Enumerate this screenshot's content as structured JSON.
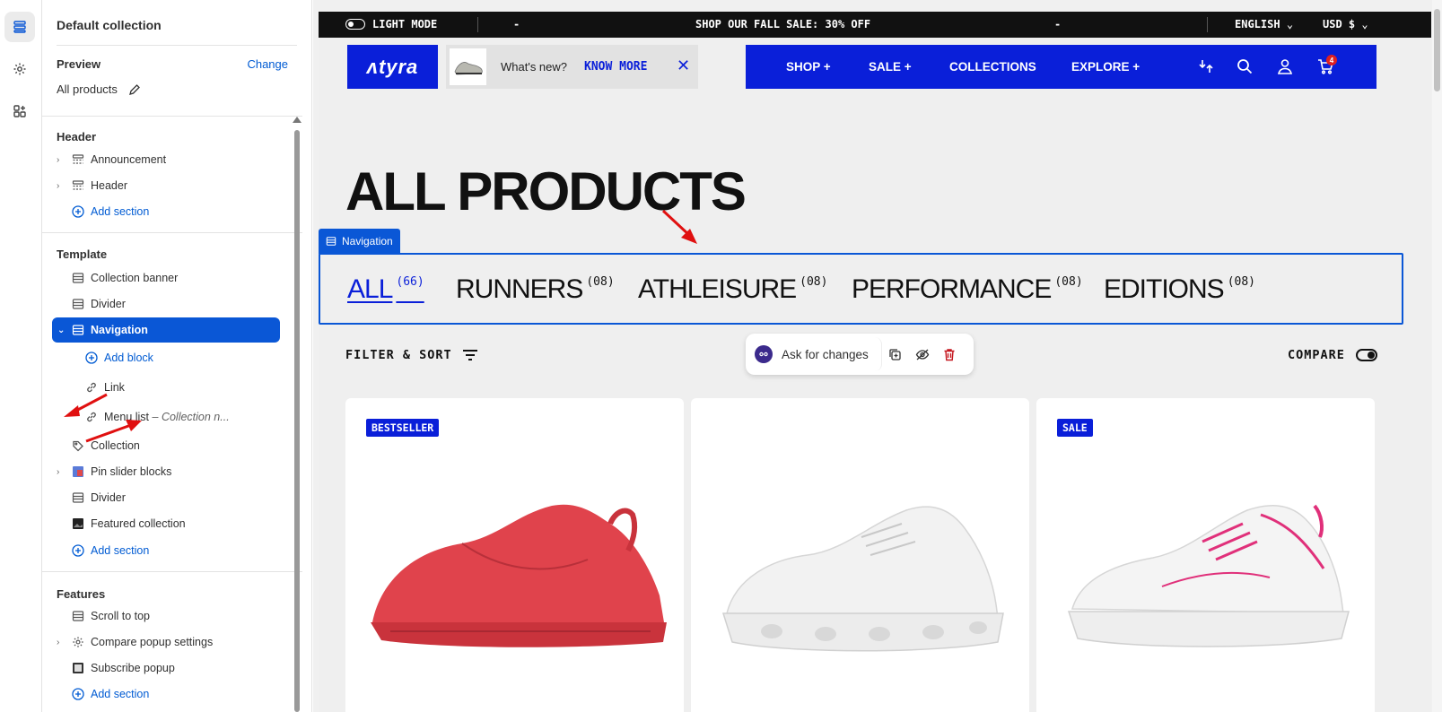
{
  "sidebar": {
    "title": "Default collection",
    "preview_label": "Preview",
    "change_label": "Change",
    "preview_value": "All products",
    "header_section": {
      "heading": "Header",
      "items": [
        "Announcement",
        "Header"
      ],
      "add_label": "Add section"
    },
    "template_section": {
      "heading": "Template",
      "items": [
        "Collection banner",
        "Divider",
        "Navigation"
      ],
      "add_block_label": "Add block",
      "blocks": [
        "Link",
        "Menu list",
        "Collection"
      ],
      "menu_list_suffix": "– Collection n...",
      "more_items": [
        "Pin slider blocks",
        "Divider",
        "Featured collection"
      ],
      "add_label": "Add section"
    },
    "features_section": {
      "heading": "Features",
      "items": [
        "Scroll to top",
        "Compare popup settings",
        "Subscribe popup"
      ],
      "add_label": "Add section"
    }
  },
  "store": {
    "announcement": {
      "mode_label": "LIGHT MODE",
      "dash1": "-",
      "message": "SHOP OUR FALL SALE: 30% OFF",
      "dash2": "-",
      "language": "ENGLISH",
      "currency": "USD $"
    },
    "logo_text": "ʌtyra",
    "whats_new": {
      "text": "What's new?",
      "link": "KNOW MORE"
    },
    "nav": {
      "shop": "SHOP +",
      "sale": "SALE +",
      "collections": "COLLECTIONS",
      "explore": "EXPLORE +",
      "cart_count": "4"
    },
    "page_title": "ALL PRODUCTS",
    "section_tag": "Navigation",
    "collections": [
      {
        "label": "ALL",
        "count": "(66)"
      },
      {
        "label": "RUNNERS",
        "count": "(08)"
      },
      {
        "label": "ATHLEISURE",
        "count": "(08)"
      },
      {
        "label": "PERFORMANCE",
        "count": "(08)"
      },
      {
        "label": "EDITIONS",
        "count": "(08)"
      }
    ],
    "filter_label": "FILTER & SORT",
    "compare_label": "COMPARE",
    "ask_label": "Ask for changes",
    "products": [
      {
        "badge": "BESTSELLER",
        "color": "#e0434c"
      },
      {
        "badge": "",
        "color": "#f2f2f2"
      },
      {
        "badge": "SALE",
        "color": "#f4f4f4"
      }
    ]
  },
  "colors": {
    "brand_blue": "#0a1fd9",
    "editor_blue": "#0a57d6",
    "link_blue": "#005bd3"
  }
}
